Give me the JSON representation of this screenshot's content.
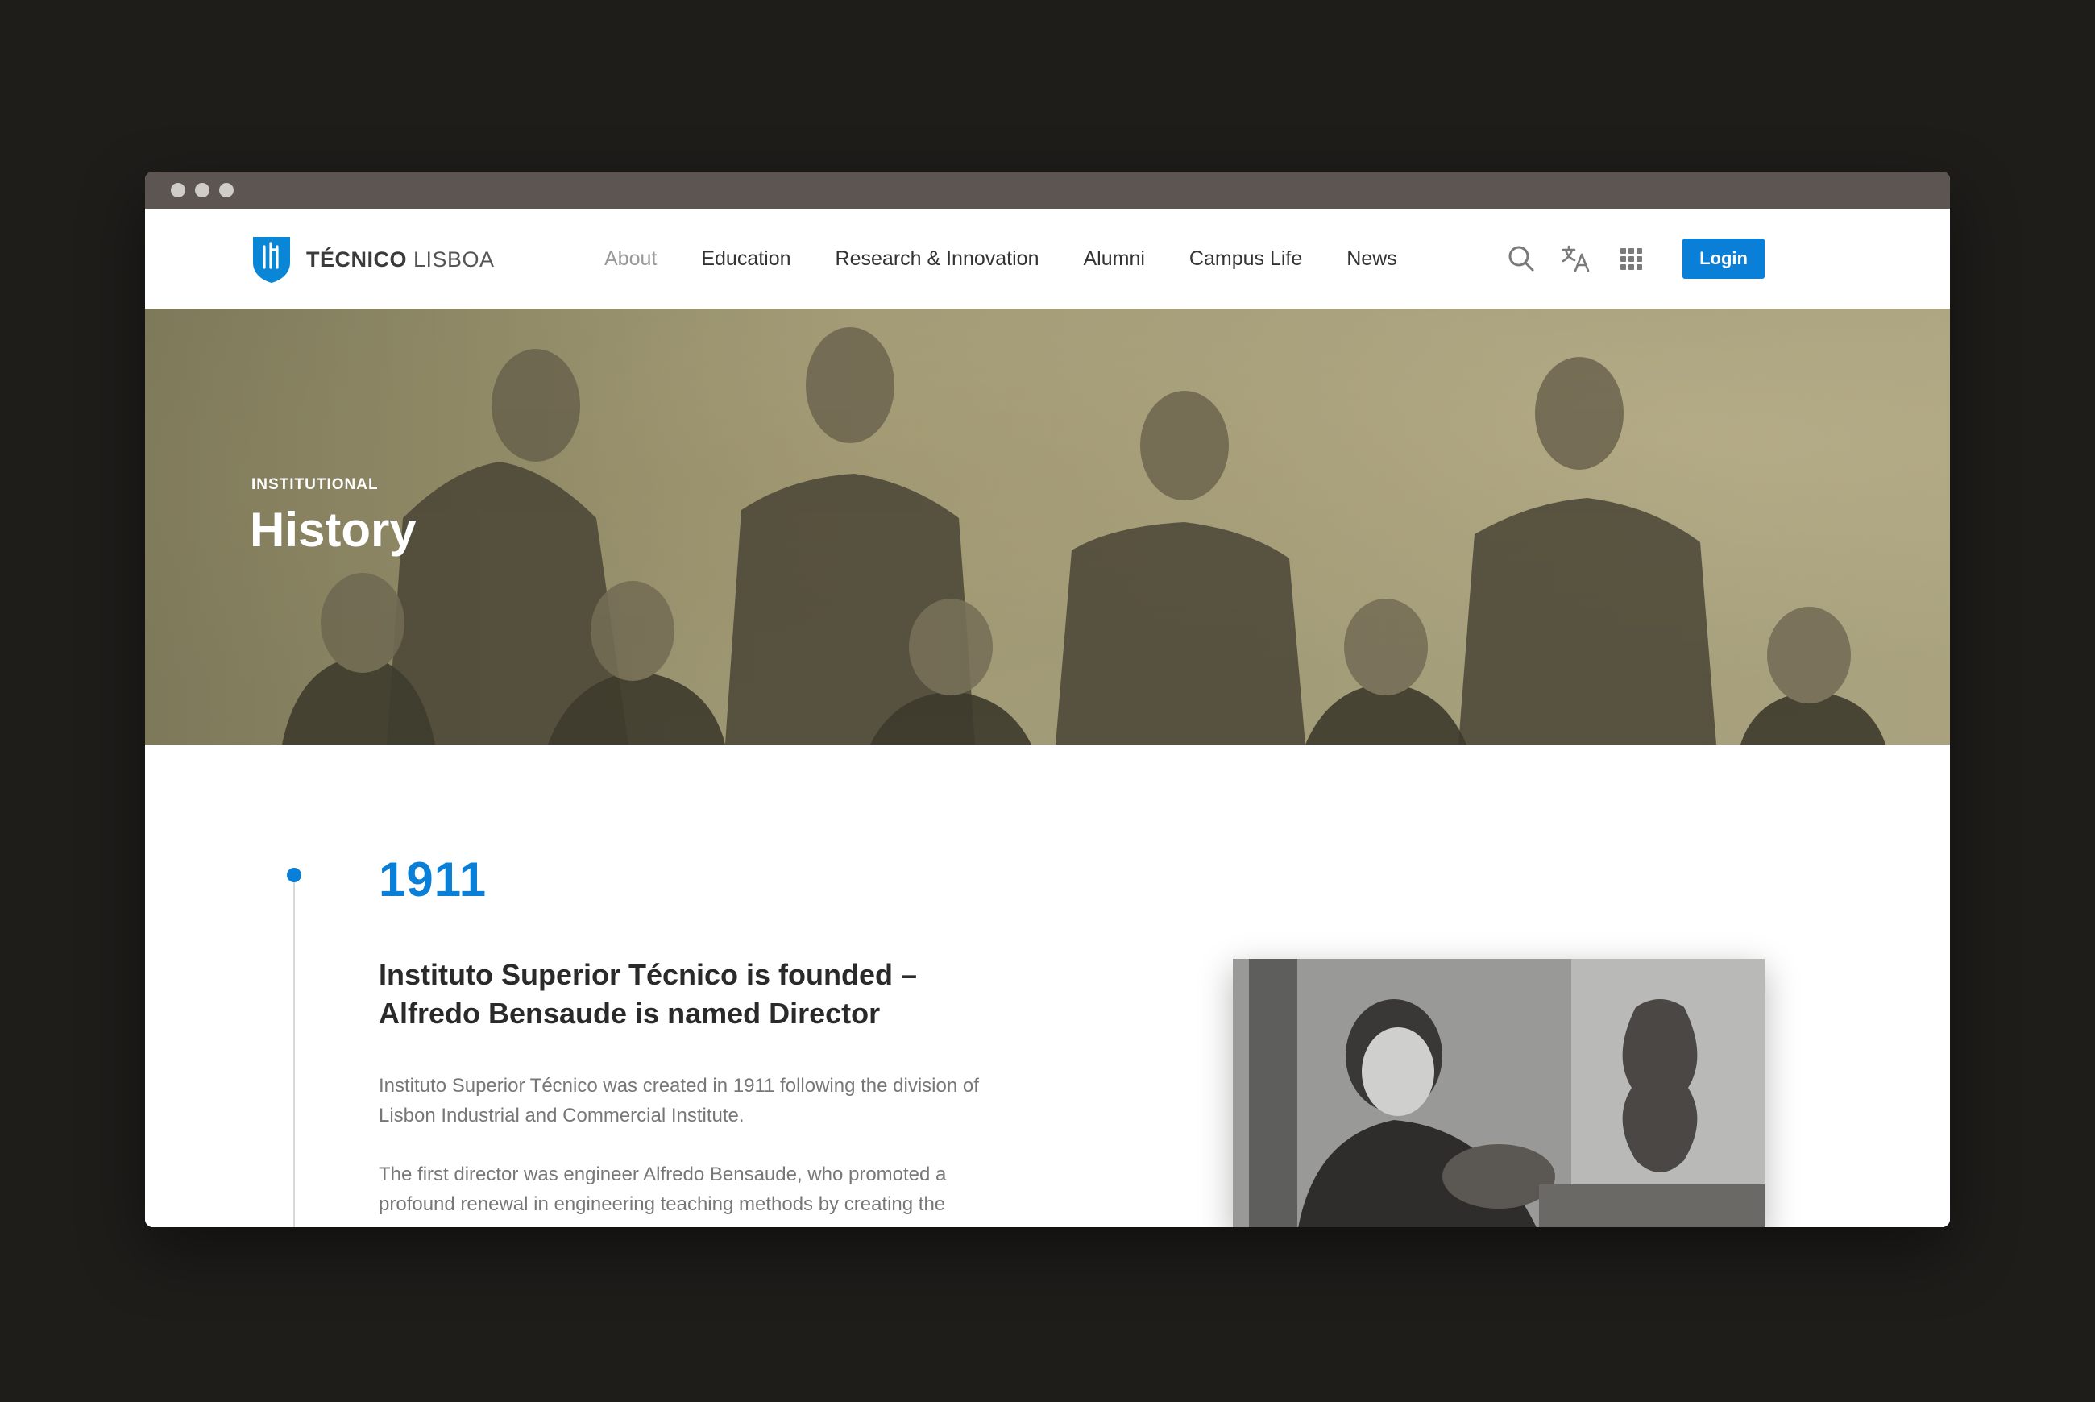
{
  "logo": {
    "brand_bold": "TÉCNICO",
    "brand_light": "LISBOA"
  },
  "nav": {
    "items": [
      {
        "label": "About",
        "active": true
      },
      {
        "label": "Education"
      },
      {
        "label": "Research & Innovation"
      },
      {
        "label": "Alumni"
      },
      {
        "label": "Campus Life"
      },
      {
        "label": "News"
      }
    ]
  },
  "tools": {
    "icons": [
      "search-icon",
      "translate-icon",
      "apps-grid-icon"
    ],
    "login_label": "Login"
  },
  "hero": {
    "kicker": "INSTITUTIONAL",
    "title": "History"
  },
  "timeline": {
    "year": "1911",
    "title": "Instituto Superior Técnico is founded – Alfredo Bensaude is named Director",
    "paragraphs": [
      "Instituto Superior Técnico was created in 1911 following the division of Lisbon Industrial and Commercial Institute.",
      "The first director was engineer Alfredo Bensaude, who promoted a profound renewal in engineering teaching methods by creating the"
    ]
  },
  "colors": {
    "accent": "#0a7fd8",
    "page_bg": "#1f1d1a",
    "chrome": "#5c5551"
  }
}
